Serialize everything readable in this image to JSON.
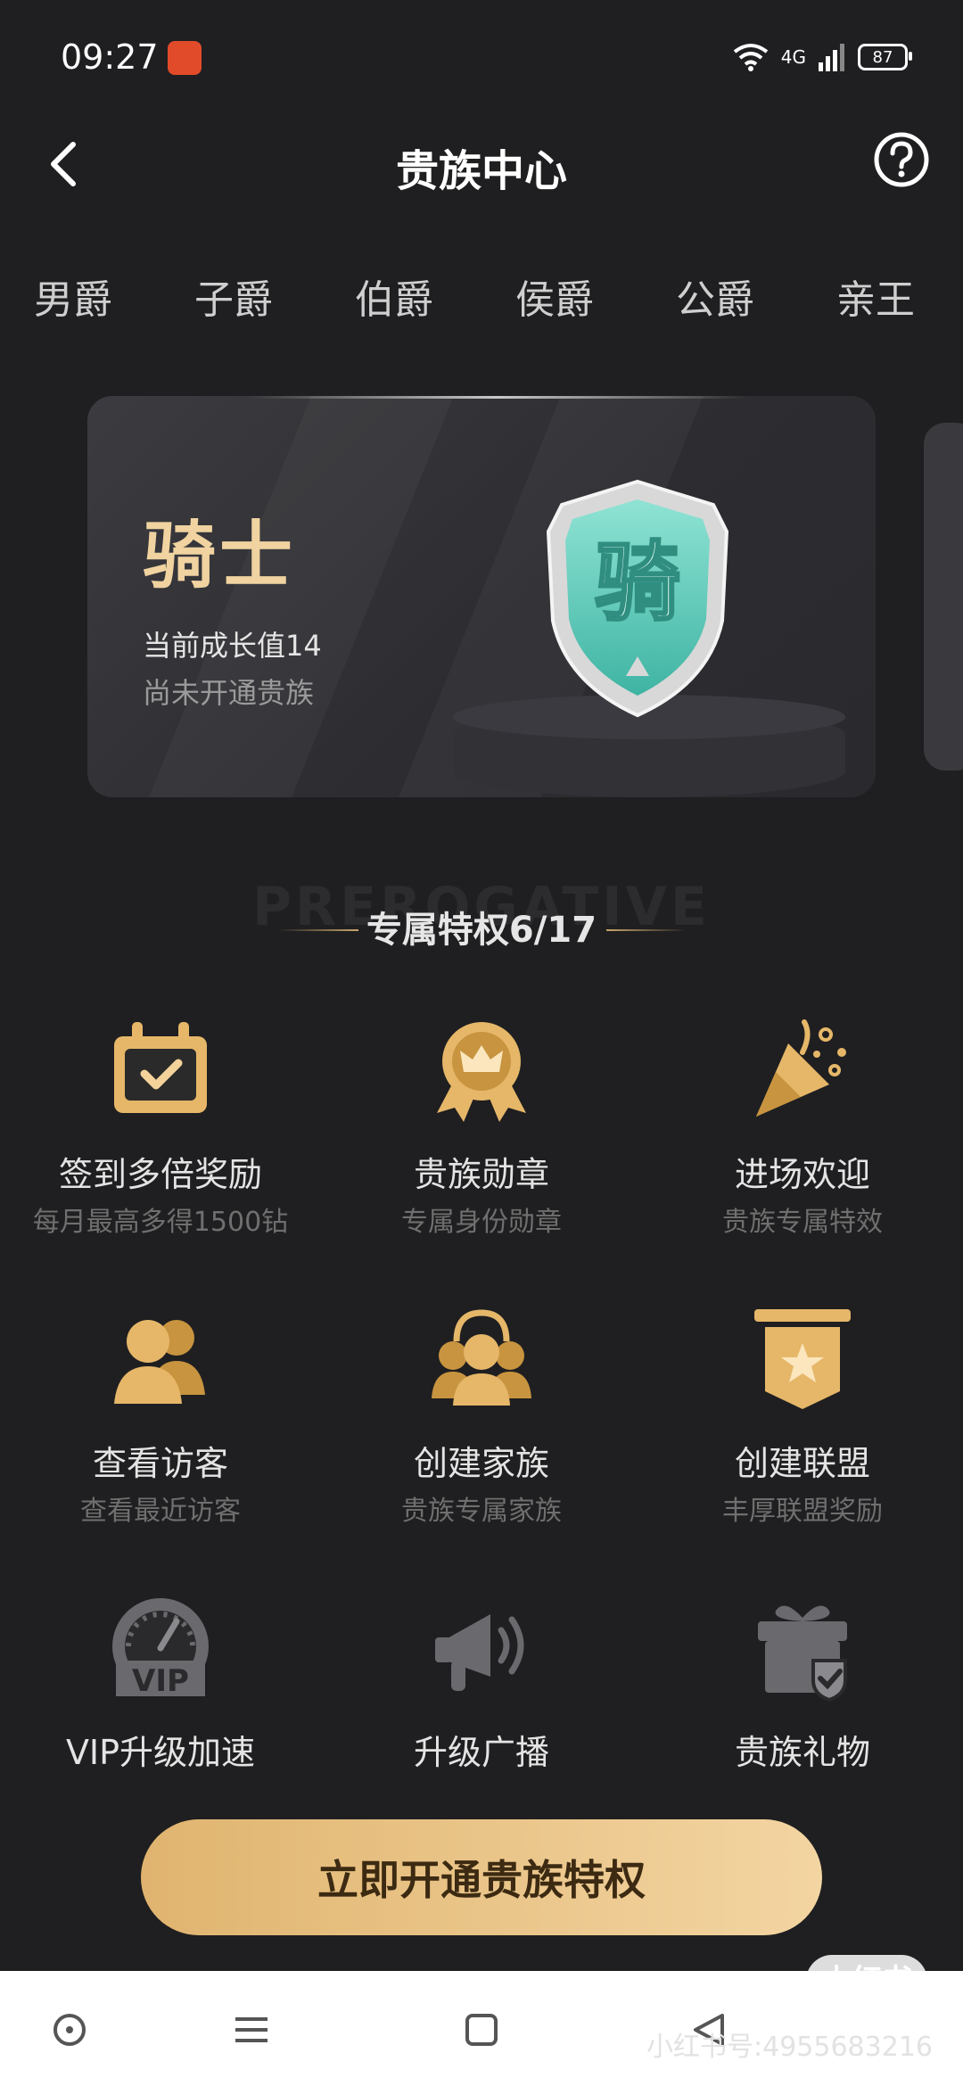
{
  "status_bar": {
    "time": "09:27",
    "network": "4G",
    "battery": "87"
  },
  "header": {
    "title": "贵族中心"
  },
  "tabs": [
    {
      "label": "男爵"
    },
    {
      "label": "子爵"
    },
    {
      "label": "伯爵"
    },
    {
      "label": "侯爵"
    },
    {
      "label": "公爵"
    },
    {
      "label": "亲王"
    }
  ],
  "rank_card": {
    "rank_name": "骑士",
    "growth_text": "当前成长值14",
    "status_text": "尚未开通贵族",
    "badge_char": "骑"
  },
  "section": {
    "watermark": "PREROGATIVE",
    "title": "专属特权6/17"
  },
  "privileges": [
    {
      "title": "签到多倍奖励",
      "desc": "每月最高多得1500钻",
      "icon": "calendar-check-icon"
    },
    {
      "title": "贵族勋章",
      "desc": "专属身份勋章",
      "icon": "crown-medal-icon"
    },
    {
      "title": "进场欢迎",
      "desc": "贵族专属特效",
      "icon": "party-popper-icon"
    },
    {
      "title": "查看访客",
      "desc": "查看最近访客",
      "icon": "visitors-icon"
    },
    {
      "title": "创建家族",
      "desc": "贵族专属家族",
      "icon": "family-icon"
    },
    {
      "title": "创建联盟",
      "desc": "丰厚联盟奖励",
      "icon": "alliance-banner-icon"
    },
    {
      "title": "VIP升级加速",
      "desc": "",
      "icon": "vip-speedometer-icon"
    },
    {
      "title": "升级广播",
      "desc": "",
      "icon": "megaphone-icon"
    },
    {
      "title": "贵族礼物",
      "desc": "",
      "icon": "gift-icon"
    }
  ],
  "cta": {
    "label": "立即开通贵族特权"
  },
  "watermark": {
    "pill": "小红书",
    "id_text": "小红书号:4955683216"
  },
  "colors": {
    "background": "#1f1f21",
    "gold": "#e0b46f",
    "gold_light": "#f3d5a2"
  }
}
